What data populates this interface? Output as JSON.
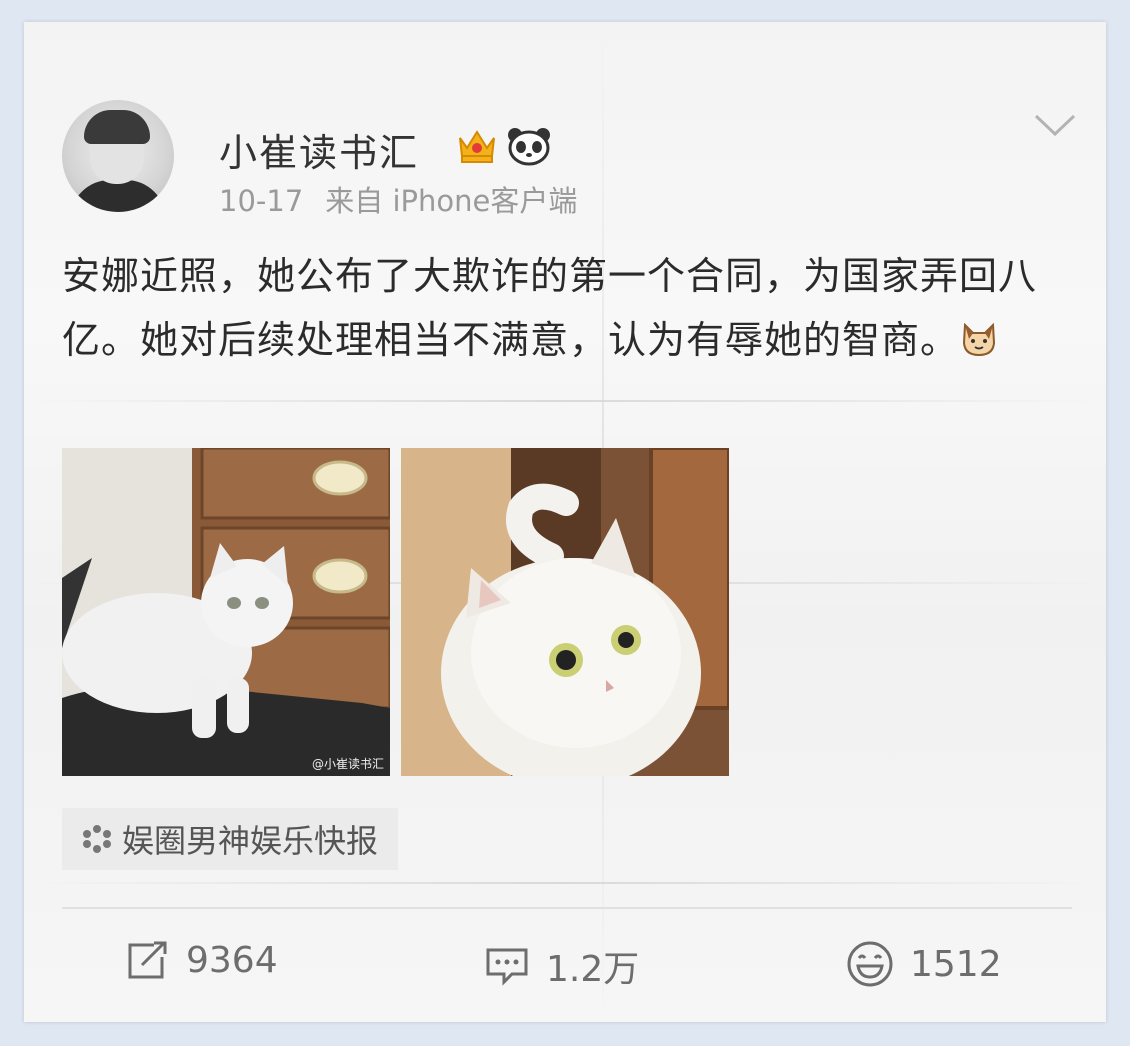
{
  "post": {
    "username": "小崔读书汇",
    "date": "10-17",
    "source": "来自 iPhone客户端",
    "text": "安娜近照，她公布了大欺诈的第一个合同，为国家弄回八亿。她对后续处理相当不满意，认为有辱她的智商。",
    "images": [
      {
        "watermark": "@小崔读书汇"
      },
      {
        "watermark": ""
      }
    ],
    "topic": "娱圈男神娱乐快报"
  },
  "actions": {
    "repost_count": "9364",
    "comment_count": "1.2万",
    "like_count": "1512"
  },
  "colors": {
    "text": "#2b2b2b",
    "meta": "#9a9a9a",
    "icon": "#6d6d6d"
  }
}
